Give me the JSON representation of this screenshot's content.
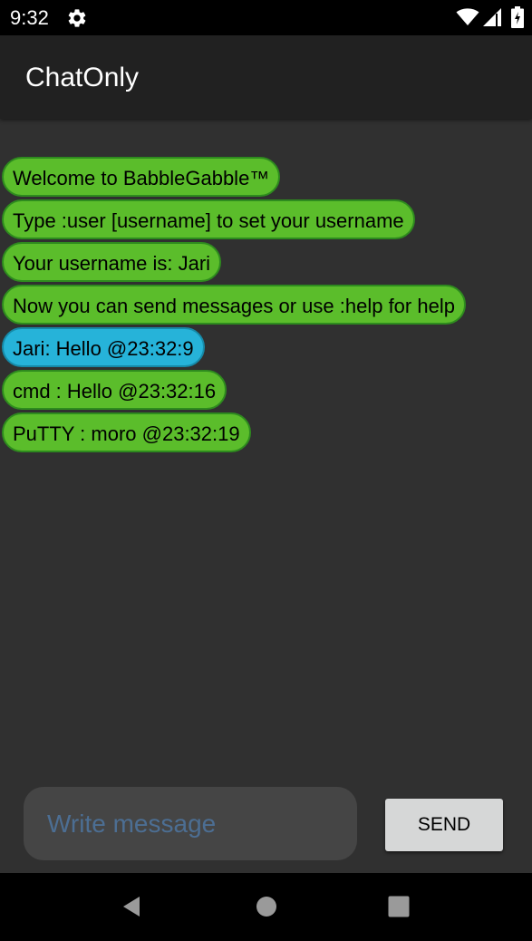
{
  "status_bar": {
    "time": "9:32",
    "icons": [
      "gear-icon",
      "wifi-icon",
      "signal-icon",
      "battery-icon"
    ]
  },
  "app_bar": {
    "title": "ChatOnly"
  },
  "messages": [
    {
      "text": "Welcome to BabbleGabble™",
      "kind": "other"
    },
    {
      "text": "Type :user [username] to set your username",
      "kind": "other"
    },
    {
      "text": "Your username is: Jari",
      "kind": "other"
    },
    {
      "text": "Now you can send messages or use :help for help",
      "kind": "other"
    },
    {
      "text": "Jari: Hello @23:32:9",
      "kind": "self"
    },
    {
      "text": "cmd : Hello @23:32:16",
      "kind": "other"
    },
    {
      "text": "PuTTY : moro @23:32:19",
      "kind": "other"
    }
  ],
  "composer": {
    "placeholder": "Write message",
    "value": "",
    "send_label": "SEND"
  },
  "nav_bar": {
    "icons": [
      "back-icon",
      "home-icon",
      "recents-icon"
    ]
  },
  "colors": {
    "bubble_other": "#5bbd2b",
    "bubble_self": "#26b3d9",
    "chat_background": "#303030",
    "app_bar": "#212121"
  }
}
